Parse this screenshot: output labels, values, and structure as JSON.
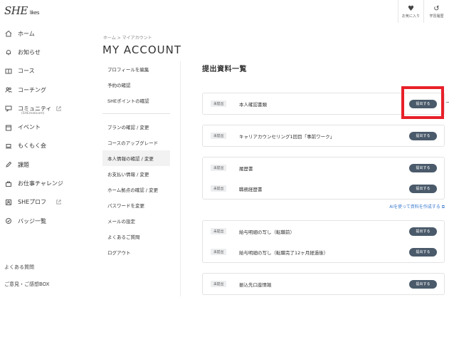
{
  "header": {
    "logo_main": "SHE",
    "logo_sub": "likes",
    "actions": [
      {
        "label": "お気に入り",
        "icon": "heart-icon"
      },
      {
        "label": "学習履歴",
        "icon": "history-icon"
      }
    ]
  },
  "sidebar": {
    "items": [
      {
        "label": "ホーム",
        "icon": "home-icon"
      },
      {
        "label": "お知らせ",
        "icon": "bell-icon"
      },
      {
        "label": "コース",
        "icon": "book-icon"
      },
      {
        "label": "コーチング",
        "icon": "people-icon"
      },
      {
        "label": "コミュニティ",
        "sublabel": "(SHEmaticom)",
        "icon": "chat-icon",
        "external": true
      },
      {
        "label": "イベント",
        "icon": "calendar-icon"
      },
      {
        "label": "もくもく会",
        "icon": "laptop-icon"
      },
      {
        "label": "課題",
        "icon": "pencil-icon"
      },
      {
        "label": "お仕事チャレンジ",
        "icon": "bag-icon"
      },
      {
        "label": "SHEプロフ",
        "icon": "profile-icon",
        "external": true
      },
      {
        "label": "バッジ一覧",
        "icon": "badge-icon"
      }
    ],
    "faq": "よくある質問",
    "feedback": "ご意見・ご感想BOX"
  },
  "breadcrumb": "ホーム > マイアカウント",
  "page_title": "MY ACCOUNT",
  "account_menu": {
    "group1": [
      "プロフィールを編集",
      "予約の確認",
      "SHEポイントの確認"
    ],
    "group2": [
      "プランの確認 / 変更",
      "コースのアップグレード",
      "本人情報の確認 / 変更",
      "お支払い情報 / 変更",
      "ホーム拠点の確認 / 変更",
      "パスワードを変更",
      "メールの設定",
      "よくあるご質問",
      "ログアウト"
    ],
    "active": "本人情報の確認 / 変更"
  },
  "main": {
    "title": "提出資料一覧",
    "ai_link": "AIを使って資料を作成する",
    "cards": [
      {
        "rows": [
          {
            "status": "未提出",
            "label": "本人確認書類",
            "button": "提出する"
          }
        ]
      },
      {
        "rows": [
          {
            "status": "未提出",
            "label": "キャリアカウンセリング1回目「事前ワーク」",
            "button": "提出する"
          }
        ]
      },
      {
        "rows": [
          {
            "status": "未提出",
            "label": "履歴書",
            "button": "提出する"
          },
          {
            "status": "未提出",
            "label": "職務経歴書",
            "button": "提出する"
          }
        ]
      },
      {
        "rows": [
          {
            "status": "未提出",
            "label": "給与明細の写し（転職前）",
            "button": "提出する"
          },
          {
            "status": "未提出",
            "label": "給与明細の写し（転職完了12ヶ月経過後）",
            "button": "提出する"
          }
        ]
      },
      {
        "rows": [
          {
            "status": "未提出",
            "label": "振込先口座情報",
            "button": "提出する"
          }
        ]
      }
    ]
  },
  "colors": {
    "button": "#4a5a6a",
    "highlight": "#e8202a",
    "link": "#3a7ad0"
  }
}
